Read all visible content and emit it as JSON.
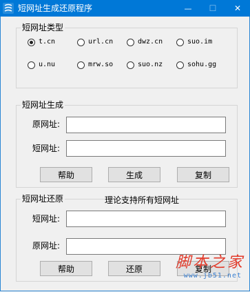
{
  "window": {
    "title": "短网址生成还原程序",
    "minimize_glyph": "—",
    "maximize_glyph": "☐",
    "close_glyph": "✕"
  },
  "type_group": {
    "title": "短网址类型",
    "options": [
      {
        "label": "t.cn",
        "checked": true
      },
      {
        "label": "url.cn",
        "checked": false
      },
      {
        "label": "dwz.cn",
        "checked": false
      },
      {
        "label": "suo.im",
        "checked": false
      },
      {
        "label": "u.nu",
        "checked": false
      },
      {
        "label": "mrw.so",
        "checked": false
      },
      {
        "label": "suo.nz",
        "checked": false
      },
      {
        "label": "sohu.gg",
        "checked": false
      }
    ]
  },
  "generate_group": {
    "title": "短网址生成",
    "original_label": "原网址:",
    "original_value": "",
    "short_label": "短网址:",
    "short_value": "",
    "help_button": "帮助",
    "generate_button": "生成",
    "copy_button": "复制"
  },
  "restore_group": {
    "title": "短网址还原",
    "note": "理论支持所有短网址",
    "short_label": "短网址:",
    "short_value": "",
    "original_label": "原网址:",
    "original_value": "",
    "help_button": "帮助",
    "restore_button": "还原",
    "copy_button": "复制"
  },
  "watermark": {
    "main": "脚本之家",
    "sub": "www.jb51.net"
  },
  "colors": {
    "titlebar": "#0078d7",
    "window_bg": "#f0f0f0",
    "watermark_red": "#e23a2a",
    "watermark_blue": "#3a7fd0"
  }
}
